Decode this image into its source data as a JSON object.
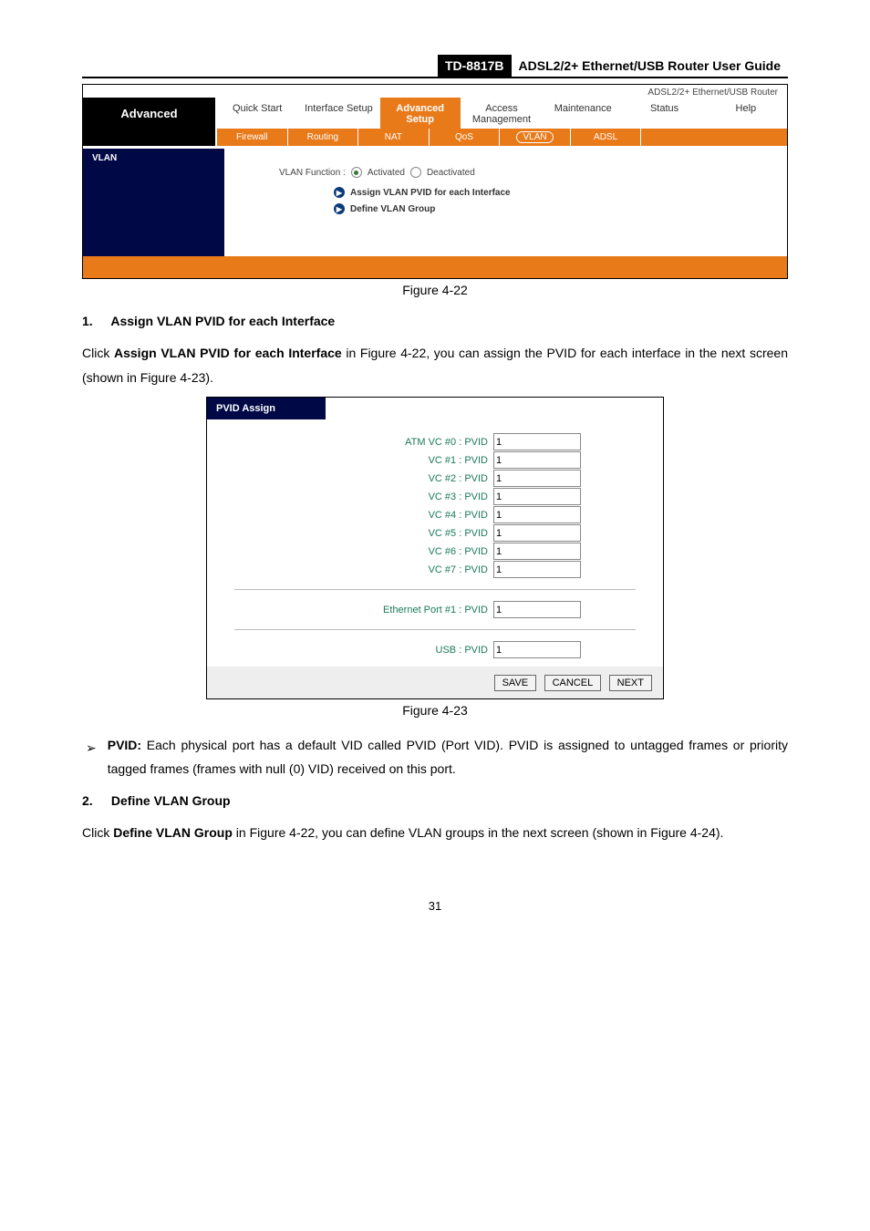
{
  "header": {
    "model": "TD-8817B",
    "title": "ADSL2/2+ Ethernet/USB Router User Guide"
  },
  "vlanshot": {
    "top_right": "ADSL2/2+ Ethernet/USB Router",
    "left_label": "Advanced",
    "tabs1": [
      "Quick Start",
      "Interface Setup",
      "Advanced Setup",
      "Access Management",
      "Maintenance",
      "Status",
      "Help"
    ],
    "tabs2": [
      "Firewall",
      "Routing",
      "NAT",
      "QoS",
      "VLAN",
      "ADSL"
    ],
    "section_label": "VLAN",
    "fn_label": "VLAN Function :",
    "opt_activated": "Activated",
    "opt_deactivated": "Deactivated",
    "link1": "Assign VLAN PVID for each Interface",
    "link2": "Define VLAN Group"
  },
  "fig1_caption": "Figure 4-22",
  "sec1": {
    "num": "1.",
    "title": "Assign VLAN PVID for each Interface",
    "p1a": "Click ",
    "p1b": "Assign VLAN PVID for each Interface",
    "p1c": " in Figure 4-22, you can assign the PVID for each interface in the next screen (shown in Figure 4-23)."
  },
  "pvidshot": {
    "head": "PVID Assign",
    "lines": [
      "ATM VC #0 : PVID",
      "VC #1 : PVID",
      "VC #2 : PVID",
      "VC #3 : PVID",
      "VC #4 : PVID",
      "VC #5 : PVID",
      "VC #6 : PVID",
      "VC #7 : PVID"
    ],
    "eth_line": "Ethernet Port #1 : PVID",
    "usb_line": "USB : PVID",
    "value": "1",
    "btn_save": "SAVE",
    "btn_cancel": "CANCEL",
    "btn_next": "NEXT"
  },
  "fig2_caption": "Figure 4-23",
  "bullet": {
    "term": "PVID:",
    "text": " Each physical port has a default VID called PVID (Port VID). PVID is assigned to untagged frames or priority tagged frames (frames with null (0) VID) received on this port."
  },
  "sec2": {
    "num": "2.",
    "title": "Define VLAN Group",
    "p1a": "Click ",
    "p1b": "Define VLAN Group",
    "p1c": " in Figure 4-22, you can define VLAN groups in the next screen (shown in Figure 4-24)."
  },
  "pagenum": "31"
}
